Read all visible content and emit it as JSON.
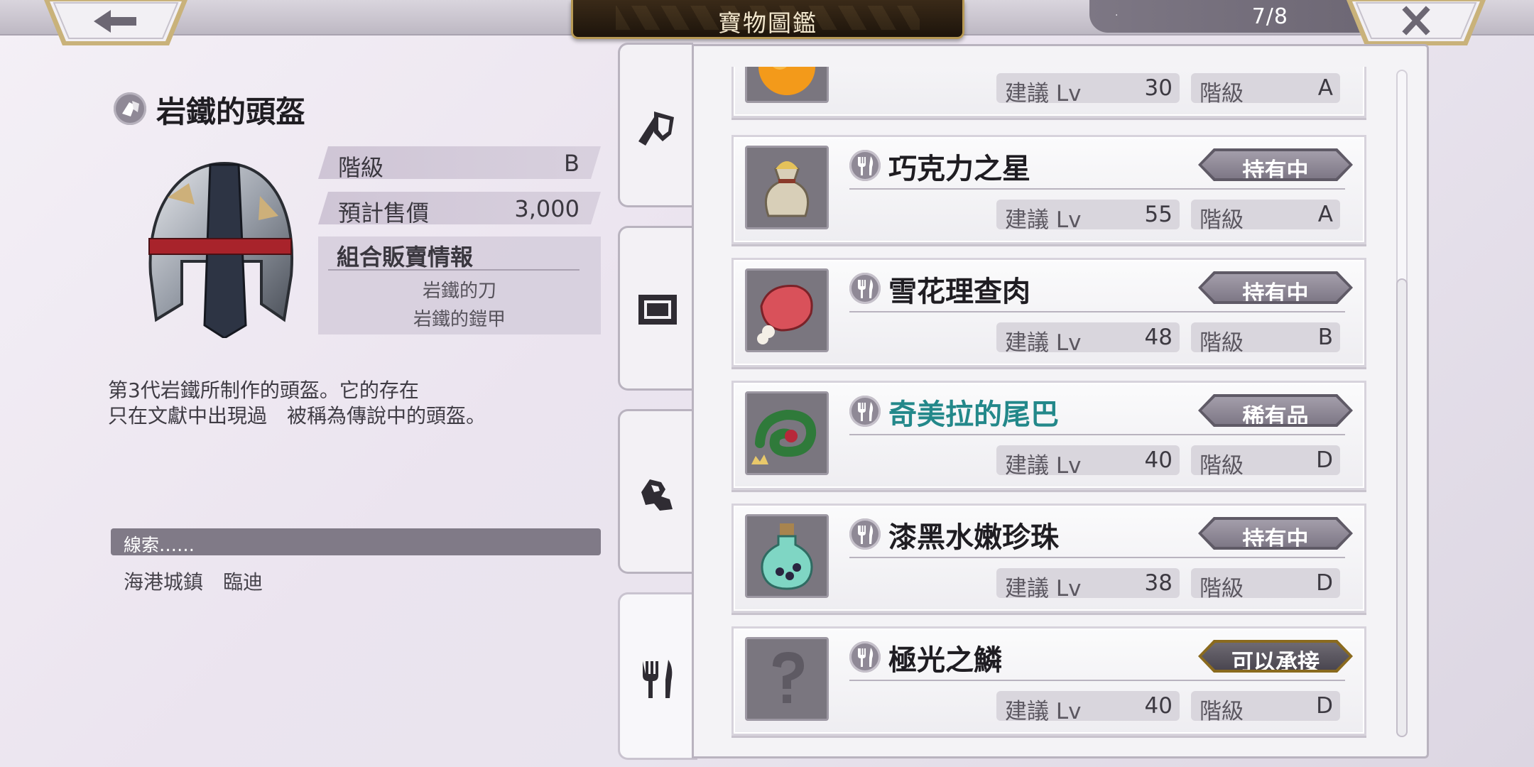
{
  "header": {
    "title": "寶物圖鑑",
    "page_indicator": "7/8",
    "page_dot": "·"
  },
  "detail": {
    "name": "岩鐵的頭盔",
    "grade_label": "階級",
    "grade_value": "B",
    "price_label": "預計售價",
    "price_value": "3,000",
    "combo_title": "組合販賣情報",
    "combo_items": [
      "岩鐵的刀",
      "岩鐵的鎧甲"
    ],
    "description_line1": "第3代岩鐵所制作的頭盔。它的存在",
    "description_line2": "只在文獻中出現過　被稱為傳說中的頭盔。",
    "clue_label": "線索……",
    "clue_location": "海港城鎮　臨迪"
  },
  "tabs": [
    "weapon-armor-icon",
    "painting-frame-icon",
    "material-ore-icon",
    "food-utensils-icon"
  ],
  "list": {
    "lv_label": "建議 Lv",
    "grade_label": "階級",
    "items": [
      {
        "name": "",
        "status": "",
        "lv": "30",
        "grade": "A",
        "thumb": "orange-fruit-icon",
        "rare": false
      },
      {
        "name": "巧克力之星",
        "status": "持有中",
        "lv": "55",
        "grade": "A",
        "thumb": "gold-sack-icon",
        "rare": false
      },
      {
        "name": "雪花理查肉",
        "status": "持有中",
        "lv": "48",
        "grade": "B",
        "thumb": "meat-bone-icon",
        "rare": false
      },
      {
        "name": "奇美拉的尾巴",
        "status": "稀有品",
        "lv": "40",
        "grade": "D",
        "thumb": "snake-tail-icon",
        "rare": true
      },
      {
        "name": "漆黑水嫩珍珠",
        "status": "持有中",
        "lv": "38",
        "grade": "D",
        "thumb": "potion-bottle-icon",
        "rare": false
      },
      {
        "name": "極光之鱗",
        "status": "可以承接",
        "lv": "40",
        "grade": "D",
        "thumb": "unknown-question-icon",
        "rare": false
      }
    ]
  },
  "colors": {
    "rare_name": "#23888a",
    "badge_gold_border": "#8a6a1e",
    "title_plate": "#1d140b",
    "clue_bar": "#807a87"
  }
}
